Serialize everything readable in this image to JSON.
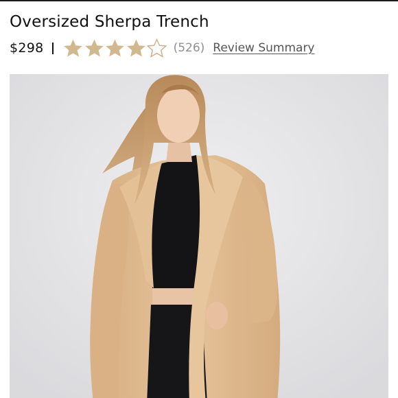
{
  "product": {
    "title": "Oversized Sherpa Trench",
    "price": "$298",
    "rating": 4,
    "rating_max": 5,
    "review_count": "(526)",
    "review_link_label": "Review Summary"
  },
  "colors": {
    "star_fill": "#d2b88f",
    "star_empty_stroke": "#c9b08a",
    "photo_background": "#e8e8ea",
    "coat": "#e2bd92"
  },
  "icons": {
    "star_filled": "star-filled-icon",
    "star_empty": "star-empty-icon"
  }
}
